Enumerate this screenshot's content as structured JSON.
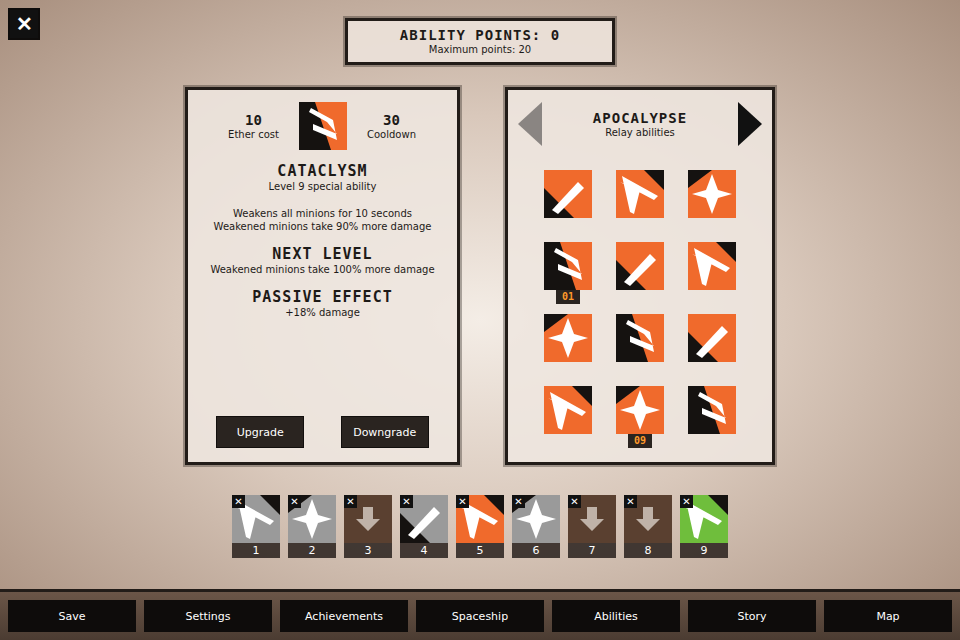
{
  "close_button": {
    "label": "✕"
  },
  "header": {
    "title": "ABILITY POINTS: 0",
    "subtitle": "Maximum points: 20"
  },
  "detail": {
    "cost": "10",
    "cost_label": "Ether cost",
    "cooldown": "30",
    "cooldown_label": "Cooldown",
    "name": "CATACLYSM",
    "level": "Level 9 special ability",
    "description": [
      "Weakens all minions for 10 seconds",
      "Weakened minions take 90% more damage"
    ],
    "next_title": "NEXT LEVEL",
    "next_text": "Weakened minions take 100% more damage",
    "passive_title": "PASSIVE EFFECT",
    "passive_text": "+18% damage",
    "buttons": [
      "Upgrade",
      "Downgrade"
    ]
  },
  "category": {
    "title": "APOCALYPSE",
    "subtitle": "Relay abilities",
    "prev_disabled": true,
    "next_disabled": false
  },
  "abilities": [
    {
      "badge": ""
    },
    {
      "badge": ""
    },
    {
      "badge": ""
    },
    {
      "badge": "01"
    },
    {
      "badge": ""
    },
    {
      "badge": ""
    },
    {
      "badge": ""
    },
    {
      "badge": ""
    },
    {
      "badge": ""
    },
    {
      "badge": ""
    },
    {
      "badge": "09"
    },
    {
      "badge": ""
    }
  ],
  "slots": [
    {
      "number": "1",
      "kind": "ability",
      "color": "#9a9a9a",
      "remove": "✕"
    },
    {
      "number": "2",
      "kind": "ability",
      "color": "#9a9a9a",
      "remove": "✕"
    },
    {
      "number": "3",
      "kind": "empty",
      "color": "#5a4030",
      "remove": "✕"
    },
    {
      "number": "4",
      "kind": "ability",
      "color": "#9a9a9a",
      "remove": "✕"
    },
    {
      "number": "5",
      "kind": "ability",
      "color": "#f06a2c",
      "remove": "✕"
    },
    {
      "number": "6",
      "kind": "ability",
      "color": "#9a9a9a",
      "remove": "✕"
    },
    {
      "number": "7",
      "kind": "empty",
      "color": "#5a4030",
      "remove": "✕"
    },
    {
      "number": "8",
      "kind": "empty",
      "color": "#5a4030",
      "remove": "✕"
    },
    {
      "number": "9",
      "kind": "ability",
      "color": "#6fbe3c",
      "remove": "✕"
    }
  ],
  "nav": [
    "Save",
    "Settings",
    "Achievements",
    "Spaceship",
    "Abilities",
    "Story",
    "Map"
  ]
}
